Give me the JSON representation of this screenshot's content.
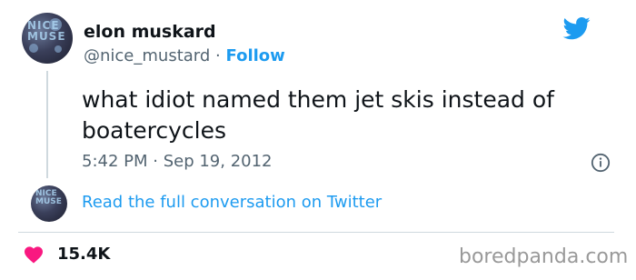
{
  "user": {
    "display_name": "elon muskard",
    "handle": "@nice_mustard",
    "separator": "·",
    "follow_label": "Follow"
  },
  "tweet": {
    "text": "what idiot named them jet skis instead of boatercycles",
    "timestamp": "5:42 PM · Sep 19, 2012"
  },
  "conversation_link": "Read the full conversation on Twitter",
  "likes": "15.4K",
  "watermark": "boredpanda.com",
  "colors": {
    "link_blue": "#1d9bf0",
    "like_red": "#f91880",
    "muted_gray": "#536471",
    "divider": "#cfd9de"
  },
  "icons": [
    "twitter-bird-icon",
    "info-icon",
    "heart-icon"
  ]
}
